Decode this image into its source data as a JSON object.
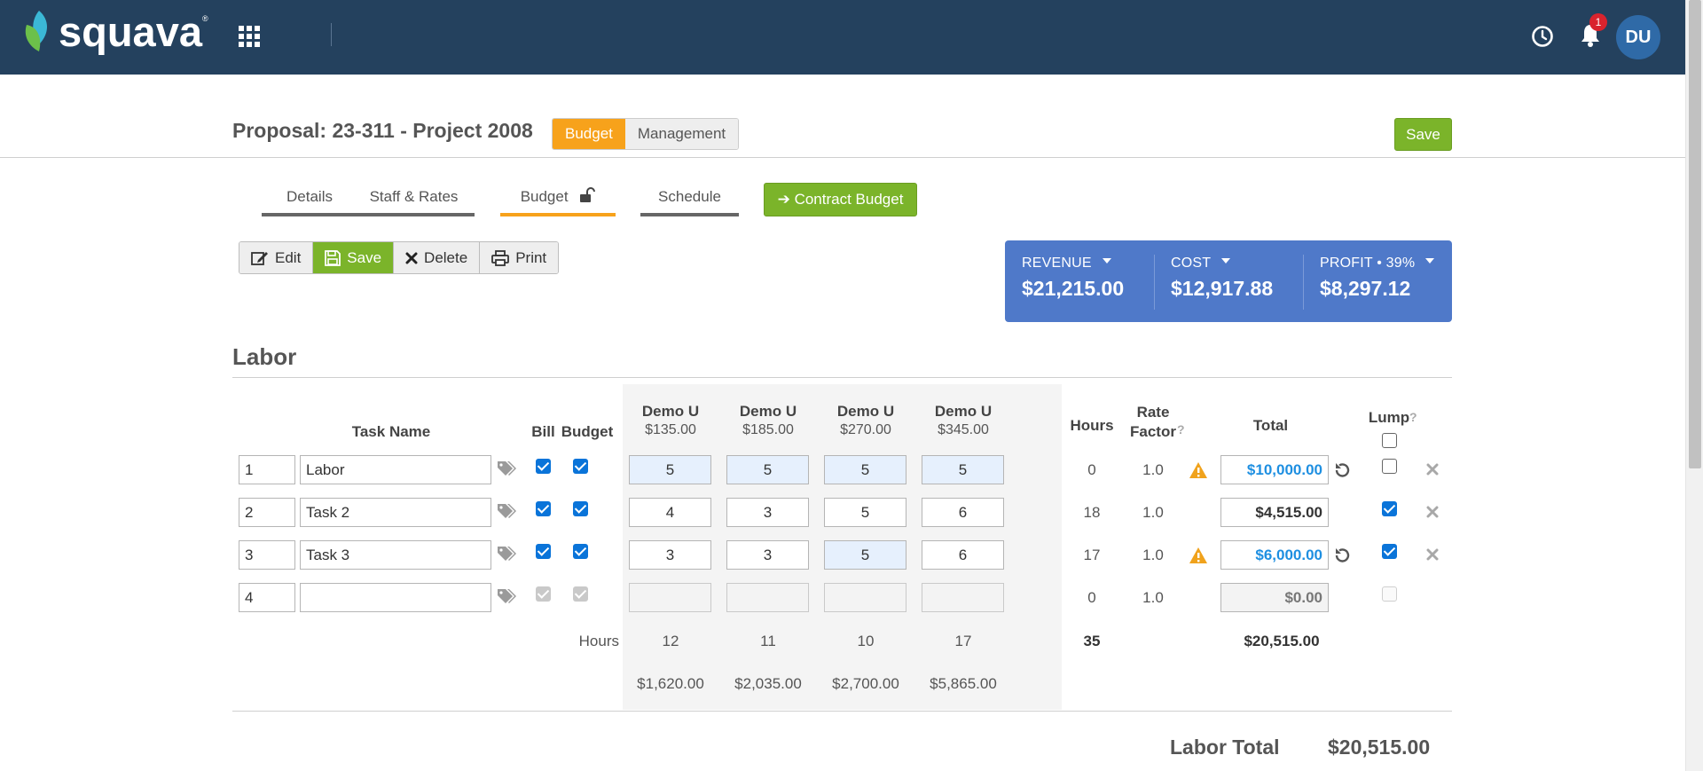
{
  "app": {
    "brand": "squava",
    "notification_count": "1",
    "user_initials": "DU"
  },
  "header": {
    "title": "Proposal: 23-311 - Project 2008",
    "mode_tabs": [
      {
        "label": "Budget",
        "active": true
      },
      {
        "label": "Management",
        "active": false
      }
    ],
    "save_label": "Save"
  },
  "subtabs": [
    {
      "label": "Details",
      "active": false
    },
    {
      "label": "Staff & Rates",
      "active": false
    },
    {
      "label": "Budget",
      "active": true,
      "icon": "unlock-icon"
    },
    {
      "label": "Schedule",
      "active": false
    }
  ],
  "contract_budget_label": "Contract Budget",
  "toolbar": {
    "edit": "Edit",
    "save": "Save",
    "delete": "Delete",
    "print": "Print"
  },
  "summary": {
    "revenue": {
      "label": "REVENUE",
      "value": "$21,215.00"
    },
    "cost": {
      "label": "COST",
      "value": "$12,917.88"
    },
    "profit": {
      "label": "PROFIT",
      "pct": "39%",
      "value": "$8,297.12"
    }
  },
  "labor": {
    "title": "Labor",
    "columns": {
      "task_name": "Task Name",
      "bill": "Bill",
      "budget": "Budget",
      "hours": "Hours",
      "rate_factor_1": "Rate",
      "rate_factor_2": "Factor",
      "total": "Total",
      "lump": "Lump",
      "help": "?"
    },
    "staff": [
      {
        "name": "Demo U",
        "rate": "$135.00"
      },
      {
        "name": "Demo U",
        "rate": "$185.00"
      },
      {
        "name": "Demo U",
        "rate": "$270.00"
      },
      {
        "name": "Demo U",
        "rate": "$345.00"
      }
    ],
    "rows": [
      {
        "num": "1",
        "name": "Labor",
        "bill": true,
        "budget": true,
        "cells": [
          "5",
          "5",
          "5",
          "5"
        ],
        "highlight": [
          true,
          true,
          true,
          true
        ],
        "hours": "0",
        "rate_factor": "1.0",
        "warning": true,
        "total": "$10,000.00",
        "total_style": "blue",
        "reset": true,
        "lump": false,
        "removable": true
      },
      {
        "num": "2",
        "name": "Task 2",
        "bill": true,
        "budget": true,
        "cells": [
          "4",
          "3",
          "5",
          "6"
        ],
        "highlight": [
          false,
          false,
          false,
          false
        ],
        "hours": "18",
        "rate_factor": "1.0",
        "warning": false,
        "total": "$4,515.00",
        "total_style": "normal",
        "reset": false,
        "lump": true,
        "removable": true
      },
      {
        "num": "3",
        "name": "Task 3",
        "bill": true,
        "budget": true,
        "cells": [
          "3",
          "3",
          "5",
          "6"
        ],
        "highlight": [
          false,
          false,
          true,
          false
        ],
        "hours": "17",
        "rate_factor": "1.0",
        "warning": true,
        "total": "$6,000.00",
        "total_style": "blue",
        "reset": true,
        "lump": true,
        "removable": true
      },
      {
        "num": "4",
        "name": "",
        "bill": true,
        "budget": true,
        "cells": [
          "",
          "",
          "",
          ""
        ],
        "highlight": [
          false,
          false,
          false,
          false
        ],
        "hours": "0",
        "rate_factor": "1.0",
        "warning": false,
        "total": "$0.00",
        "total_style": "gray",
        "reset": false,
        "lump": false,
        "removable": false
      }
    ],
    "totals": {
      "hours_label": "Hours",
      "staff_hours": [
        "12",
        "11",
        "10",
        "17"
      ],
      "staff_costs": [
        "$1,620.00",
        "$2,035.00",
        "$2,700.00",
        "$5,865.00"
      ],
      "total_hours": "35",
      "total_amount": "$20,515.00"
    },
    "labor_total_label": "Labor Total",
    "labor_total_value": "$20,515.00"
  }
}
